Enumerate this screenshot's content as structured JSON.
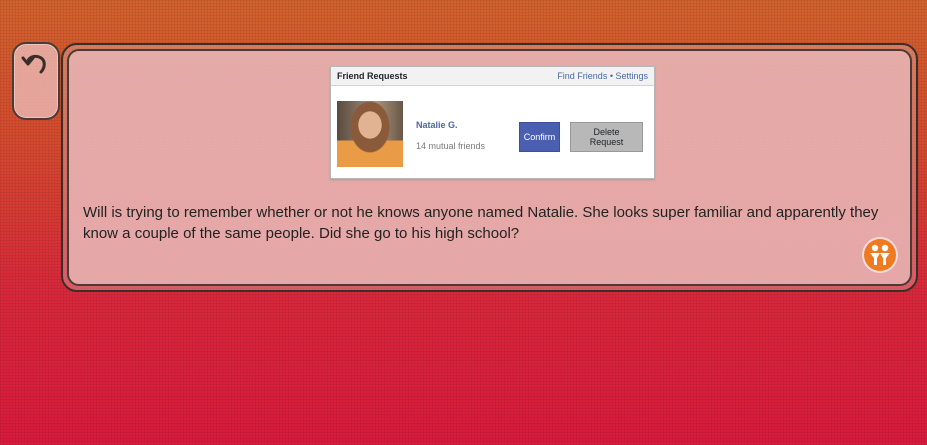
{
  "back": {
    "icon": "undo-arrow-icon"
  },
  "friend_requests": {
    "title": "Friend Requests",
    "links": "Find Friends • Settings",
    "request": {
      "name": "Natalie G.",
      "mutual": "14 mutual friends",
      "confirm_label": "Confirm",
      "delete_label": "Delete Request"
    }
  },
  "story": {
    "text": "Will is trying to remember whether or not he knows anyone named Natalie. She looks super familiar and apparently they know a couple of the same people. Did she go to his high school?"
  },
  "badge": {
    "icon": "two-people-icon",
    "color": "#f07a1f"
  },
  "colors": {
    "confirm": "#4b5fb1",
    "link": "#4b67a1",
    "background_top": "#d1622c",
    "background_bottom": "#d91a3d"
  }
}
